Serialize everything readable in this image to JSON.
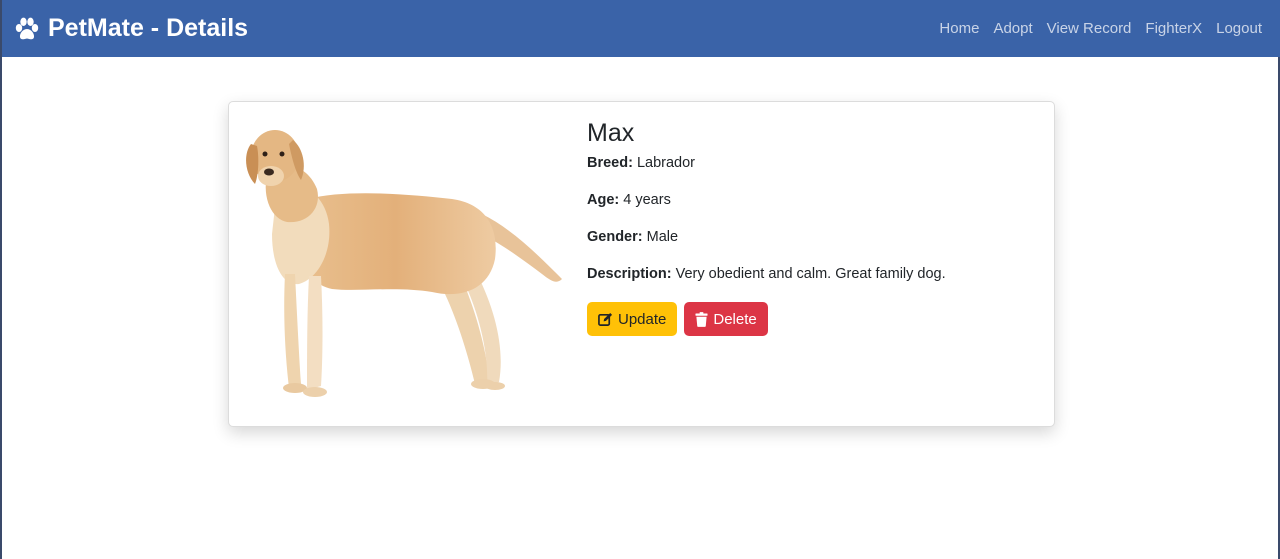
{
  "navbar": {
    "brand_icon": "paw-icon",
    "brand_title": "PetMate - Details",
    "links": [
      "Home",
      "Adopt",
      "View Record",
      "FighterX",
      "Logout"
    ],
    "background": "#3a63a8"
  },
  "pet": {
    "name": "Max",
    "image": "labrador-dog-photo",
    "fields": [
      {
        "label": "Breed:",
        "value": "Labrador"
      },
      {
        "label": "Age:",
        "value": "4 years"
      },
      {
        "label": "Gender:",
        "value": "Male"
      },
      {
        "label": "Description:",
        "value": "Very obedient and calm. Great family dog."
      }
    ]
  },
  "actions": {
    "update_label": "Update",
    "update_icon": "edit-icon",
    "update_color": "#ffc107",
    "delete_label": "Delete",
    "delete_icon": "trash-icon",
    "delete_color": "#dc3545"
  }
}
